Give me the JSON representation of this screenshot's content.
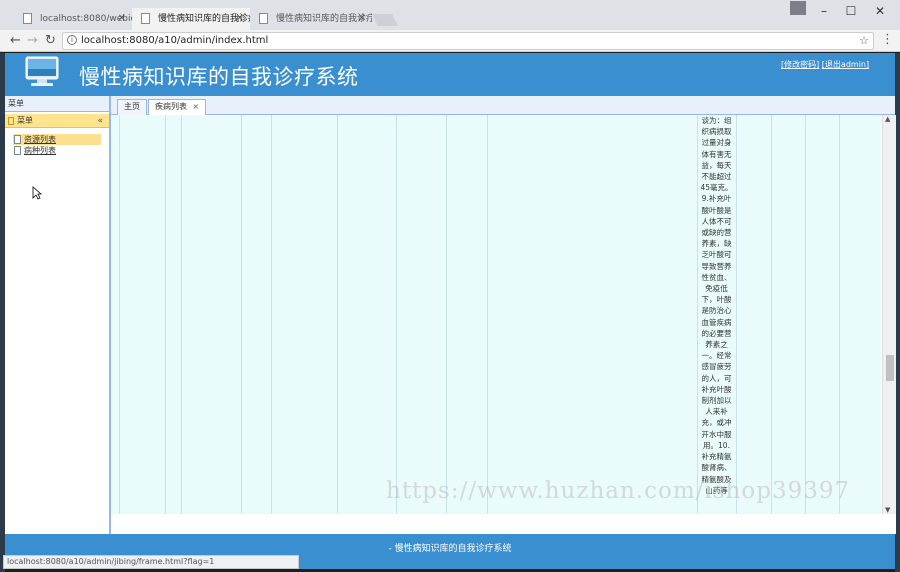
{
  "browser": {
    "tabs": [
      {
        "title": "localhost:8080/webido",
        "active": false
      },
      {
        "title": "慢性病知识库的自我诊疗",
        "active": true
      },
      {
        "title": "慢性病知识库的自我诊疗",
        "active": false
      }
    ],
    "url": "localhost:8080/a10/admin/index.html",
    "status_url": "localhost:8080/a10/admin/jibing/frame.html?flag=1"
  },
  "app": {
    "title": "慢性病知识库的自我诊疗系统",
    "header_links": [
      "[修改密码]",
      "[退出admin]"
    ],
    "footer": "- 慢性病知识库的自我诊疗系统"
  },
  "sidebar": {
    "header": "菜单",
    "accordion_title": "菜单",
    "items": [
      {
        "label": "资源列表",
        "selected": true
      },
      {
        "label": "病种列表",
        "selected": false
      }
    ]
  },
  "content": {
    "tabs": [
      {
        "label": "主页",
        "closable": false
      },
      {
        "label": "疾病列表",
        "closable": true,
        "close": "×"
      }
    ],
    "cell_text": "谈为：组织病损取过量对身体有害无益，每天不能超过45毫克。9.补充叶酸叶酸是人体不可或缺的营养素，缺乏叶酸可导致营养性贫血、免疫低下，叶酸是防治心血管疾病的必要营养素之一。经常感冒疲劳的人，可补充叶酸制剂加以人来补充，或冲开水中服用。10.补充精氨酸肾病、精氨酸及山药等"
  },
  "watermark": "https://www.huzhan.com/ishop39397"
}
